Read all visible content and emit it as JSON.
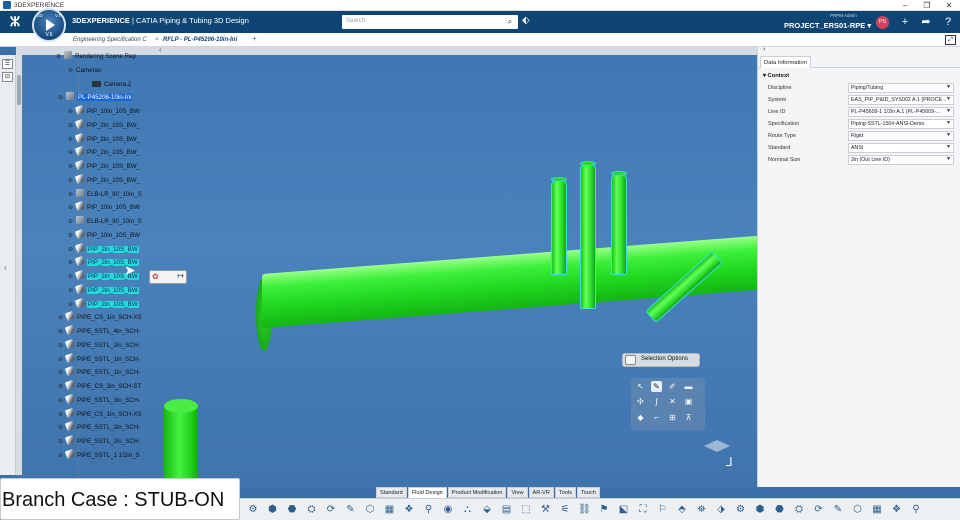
{
  "os_window": {
    "title": "3DEXPERIENCE",
    "controls": [
      "–",
      "❐",
      "✕"
    ]
  },
  "header": {
    "brand_bold": "3DEXPERIENCE",
    "brand_rest": " | CATIA  Piping & Tubing 3D Design",
    "compass_version": "V.6",
    "compass_q": [
      "3D",
      "V.R"
    ],
    "search_placeholder": "Search",
    "user_sub": "PRPM Admin",
    "project": "PROJECT_ERS01-RPE ▾",
    "avatar_initials": "PS"
  },
  "tabs": [
    {
      "label": "Engineering Specification C"
    },
    {
      "label": "RFLP - PL-P45206-10in-Ini"
    }
  ],
  "tree": {
    "nodes": [
      {
        "label": "Rendering Scene Rep"
      },
      {
        "label": "Cameras"
      },
      {
        "label": "Camera.2"
      },
      {
        "label": "PL-P45206-10in-Ini"
      },
      {
        "label": "PIP_10in_10S_BW"
      },
      {
        "label": "PIP_2in_10S_BW_"
      },
      {
        "label": "PIP_2in_10S_BW_"
      },
      {
        "label": "PIP_2in_10S_BW_"
      },
      {
        "label": "PIP_2in_10S_BW_"
      },
      {
        "label": "PIP_2in_10S_BW_"
      },
      {
        "label": "ELB-LR_90_10in_S"
      },
      {
        "label": "PIP_10in_10S_BW"
      },
      {
        "label": "ELB-LR_90_10in_S"
      },
      {
        "label": "PIP_10in_10S_BW"
      },
      {
        "label": "PIP_2in_10S_BW"
      },
      {
        "label": "PIP_2in_10S_BW"
      },
      {
        "label": "PIP_2in_10S_BW"
      },
      {
        "label": "PIP_2in_10S_BW"
      },
      {
        "label": "PIP_2in_10S_BW"
      },
      {
        "label": "PIPE_CS_1in_SCH-XS"
      },
      {
        "label": "PIPE_SSTL_4in_SCH-"
      },
      {
        "label": "PIPE_SSTL_2in_SCH-"
      },
      {
        "label": "PIPE_SSTL_1in_SCH-"
      },
      {
        "label": "PIPE_SSTL_1in_SCH-"
      },
      {
        "label": "PIPE_CS_2in_SCH-ST"
      },
      {
        "label": "PIPE_SSTL_3in_SCH-"
      },
      {
        "label": "PIPE_CS_1in_SCH-XS"
      },
      {
        "label": "PIPE_SSTL_2in_SCH-"
      },
      {
        "label": "PIPE_SSTL_2in_SCH-"
      },
      {
        "label": "PIPE_SSTL_1 1/2in_S"
      }
    ]
  },
  "selection_options": {
    "title": "Selection Options"
  },
  "data_panel": {
    "tab": "Data Information",
    "section": "Context",
    "properties": [
      {
        "label": "Discipline",
        "value": "Piping/Tubing"
      },
      {
        "label": "System",
        "value": "EAS_PIP_P&ID_SYS002 A.1 (PROCE..."
      },
      {
        "label": "Line ID",
        "value": "PL-P45609-1 1/2in A.1 (PL-P45609-..."
      },
      {
        "label": "Specification",
        "value": "Piping-SSTL-150#-ANSI-Demo"
      },
      {
        "label": "Route Type",
        "value": "Rigid"
      },
      {
        "label": "Standard",
        "value": "ANSI"
      },
      {
        "label": "Nominal Size",
        "value": "2in (Out Line ID)"
      }
    ]
  },
  "action_tabs": [
    "Standard",
    "Fluid Design",
    "Product Modification",
    "View",
    "AR-VR",
    "Tools",
    "Touch"
  ],
  "caption": "Branch Case : STUB-ON"
}
